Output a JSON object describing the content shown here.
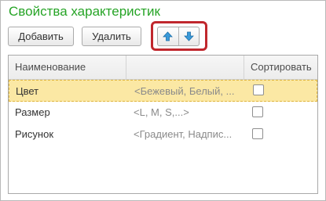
{
  "form": {
    "title": "Свойства характеристик"
  },
  "toolbar": {
    "add_label": "Добавить",
    "delete_label": "Удалить",
    "move_up_icon": "arrow-up-icon",
    "move_down_icon": "arrow-down-icon",
    "highlight_color": "#c0272d"
  },
  "table": {
    "columns": [
      "Наименование",
      "",
      "Сортировать"
    ],
    "rows": [
      {
        "name": "Цвет",
        "values": "<Бежевый, Белый, ...",
        "sort": false,
        "selected": true
      },
      {
        "name": "Размер",
        "values": "<L, M, S,...>",
        "sort": false,
        "selected": false
      },
      {
        "name": "Рисунок",
        "values": "<Градиент, Надпис...",
        "sort": false,
        "selected": false
      }
    ]
  },
  "colors": {
    "title": "#26a426",
    "selected_row": "#fbe8a4",
    "arrow_fill": "#3a9ad9"
  }
}
